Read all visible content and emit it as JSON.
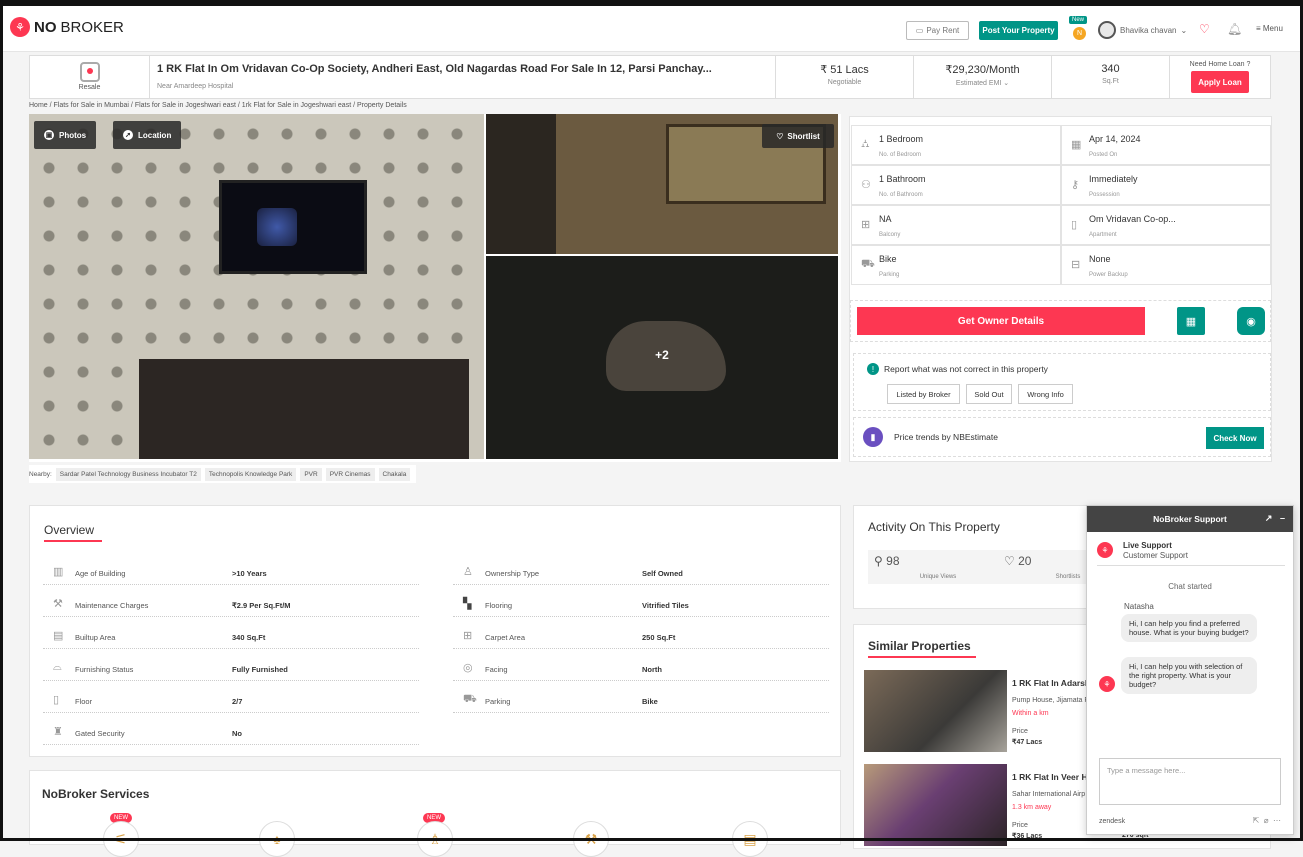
{
  "header": {
    "logo_mark": "⚘",
    "logo_bold": "NO",
    "logo_rest": "BROKER",
    "pay_rent": "Pay Rent",
    "post_property": "Post Your Property",
    "new_tag": "New",
    "coin": "N",
    "user_name": "Bhavika chavan",
    "menu": "Menu"
  },
  "summary": {
    "badge": "Resale",
    "title": "1 RK Flat In Om Vridavan Co-Op Society, Andheri East, Old Nagardas Road For Sale In 12, Parsi Panchay...",
    "subtitle": "Near Amardeep Hospital",
    "price": "₹ 51 Lacs",
    "price_note": "Negotiable",
    "emi": "₹29,230/Month",
    "emi_note": "Estimated EMI",
    "area": "340",
    "area_unit": "Sq.Ft",
    "loan_q": "Need Home Loan ?",
    "loan_btn": "Apply Loan"
  },
  "breadcrumb": "Home / Flats for Sale in Mumbai / Flats for Sale in Jogeshwari east / 1rk Flat for Sale in Jogeshwari east / Property Details",
  "gallery": {
    "photos": "Photos",
    "location": "Location",
    "shortlist": "Shortlist",
    "more": "+2"
  },
  "nearby": {
    "label": "Nearby:",
    "items": [
      "Sardar Patel Technology Business Incubator T2",
      "Technopolis Knowledge Park",
      "PVR",
      "PVR Cinemas",
      "Chakala"
    ]
  },
  "details": [
    {
      "value": "1 Bedroom",
      "label": "No. of Bedroom",
      "icon": "bed-icon"
    },
    {
      "value": "Apr 14, 2024",
      "label": "Posted On",
      "icon": "calendar-icon"
    },
    {
      "value": "1 Bathroom",
      "label": "No. of Bathroom",
      "icon": "bath-icon"
    },
    {
      "value": "Immediately",
      "label": "Possession",
      "icon": "key-icon"
    },
    {
      "value": "NA",
      "label": "Balcony",
      "icon": "balcony-icon"
    },
    {
      "value": "Om Vridavan Co-op...",
      "label": "Apartment",
      "icon": "building-icon"
    },
    {
      "value": "Bike",
      "label": "Parking",
      "icon": "car-icon"
    },
    {
      "value": "None",
      "label": "Power Backup",
      "icon": "battery-icon"
    }
  ],
  "actions": {
    "owner": "Get Owner Details",
    "report_text": "Report what was not correct in this property",
    "report_options": [
      "Listed by Broker",
      "Sold Out",
      "Wrong Info"
    ],
    "trend_text": "Price trends by NBEstimate",
    "check_now": "Check Now"
  },
  "overview": {
    "title": "Overview",
    "left": [
      {
        "k": "Age of Building",
        "v": ">10 Years",
        "icon": "building-age-icon"
      },
      {
        "k": "Maintenance Charges",
        "v": "₹2.9 Per Sq.Ft/M",
        "icon": "tools-icon"
      },
      {
        "k": "Builtup Area",
        "v": "340 Sq.Ft",
        "icon": "area-icon"
      },
      {
        "k": "Furnishing Status",
        "v": "Fully Furnished",
        "icon": "sofa-icon"
      },
      {
        "k": "Floor",
        "v": "2/7",
        "icon": "floor-icon"
      },
      {
        "k": "Gated Security",
        "v": "No",
        "icon": "guard-icon"
      }
    ],
    "right": [
      {
        "k": "Ownership Type",
        "v": "Self Owned",
        "icon": "owner-icon"
      },
      {
        "k": "Flooring",
        "v": "Vitrified Tiles",
        "icon": "tiles-icon"
      },
      {
        "k": "Carpet Area",
        "v": "250 Sq.Ft",
        "icon": "carpet-icon"
      },
      {
        "k": "Facing",
        "v": "North",
        "icon": "compass-icon"
      },
      {
        "k": "Parking",
        "v": "Bike",
        "icon": "car-icon"
      }
    ]
  },
  "services": {
    "title": "NoBroker Services",
    "new": "NEW"
  },
  "activity": {
    "title": "Activity On This Property",
    "views": "98",
    "views_label": "Unique Views",
    "shortlists": "20",
    "shortlists_label": "Shortlists"
  },
  "similar": {
    "title": "Similar Properties",
    "items": [
      {
        "title": "1 RK Flat In Adarsh",
        "loc": "Pump House, Jijamata R",
        "dist": "Within a km",
        "price_label": "Price",
        "price": "₹47 Lacs"
      },
      {
        "title": "1 RK Flat In Veer H",
        "loc": "Sahar International Airp",
        "dist": "1.3 km away",
        "price_label": "Price",
        "price": "₹36 Lacs",
        "area": "270 sqft"
      }
    ]
  },
  "chat": {
    "title": "NoBroker Support",
    "support_title": "Live Support",
    "support_sub": "Customer Support",
    "started": "Chat started",
    "agent": "Natasha",
    "msg1": "Hi, I can help you find a preferred house. What is your buying budget?",
    "msg2": "Hi, I can help you with selection of the right property. What is your budget?",
    "placeholder": "Type a message here...",
    "brand": "zendesk"
  }
}
